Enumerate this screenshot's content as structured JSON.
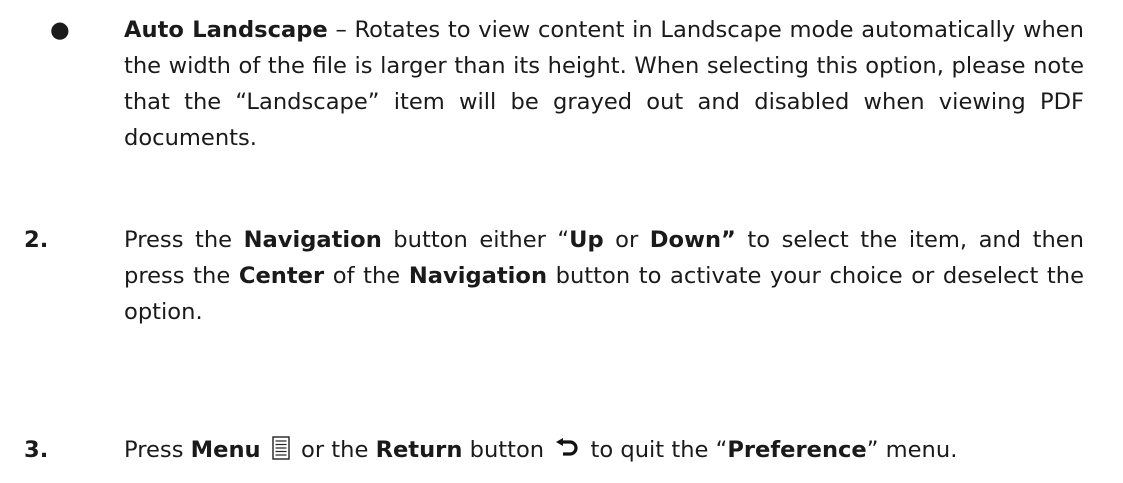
{
  "bullet_item": {
    "marker": "●",
    "title": "Auto Landscape",
    "text": " – Rotates to view content in Landscape mode automatically when the width of the file is larger than its height. When selecting this option, please note that the “Landscape” item will be grayed out and disabled when viewing PDF documents."
  },
  "step2": {
    "number": "2.",
    "t1": "Press the ",
    "b1": "Navigation",
    "t2": " button either “",
    "b2": "Up",
    "t3": " or ",
    "b3": "Down”",
    "t4": " to select the item, and then press the ",
    "b4": "Center",
    "t5": " of the ",
    "b5": "Navigation",
    "t6": " button to activate your choice or deselect the option."
  },
  "step3": {
    "number": "3.",
    "t1": "Press ",
    "b1": "Menu",
    "t2": " or the ",
    "b2": "Return",
    "t3": " button ",
    "t4": " to quit the “",
    "b3": "Preference",
    "t5": "” menu.",
    "menu_icon": "menu-list-icon",
    "return_icon": "return-arrow-icon"
  }
}
